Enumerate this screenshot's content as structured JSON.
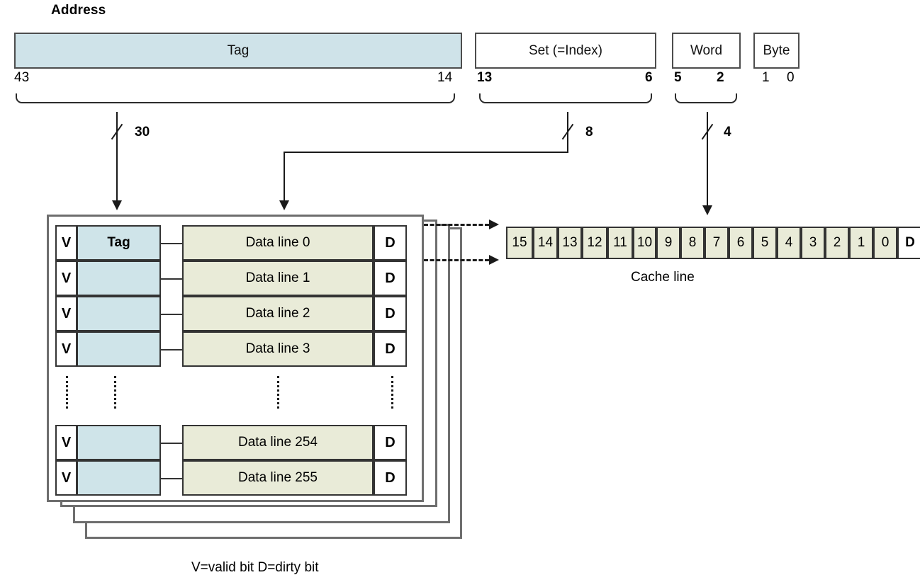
{
  "diagram": {
    "title": "Address",
    "legend": "V=valid bit        D=dirty bit",
    "cache_line_caption": "Cache line"
  },
  "address_fields": [
    {
      "label": "Tag",
      "hi": "43",
      "lo": "14",
      "bold_bits": false,
      "filled": true,
      "width_annotation": "30"
    },
    {
      "label": "Set (=Index)",
      "hi": "13",
      "lo": "6",
      "bold_bits": true,
      "filled": false,
      "width_annotation": "8"
    },
    {
      "label": "Word",
      "hi": "5",
      "lo": "2",
      "bold_bits": true,
      "filled": false,
      "width_annotation": "4"
    },
    {
      "label": "Byte",
      "hi": "1",
      "lo": "0",
      "bold_bits": false,
      "filled": false,
      "width_annotation": ""
    }
  ],
  "cache_array": {
    "valid_label": "V",
    "dirty_label": "D",
    "tag_header": "Tag",
    "rows_top": [
      {
        "data": "Data line 0"
      },
      {
        "data": "Data line 1"
      },
      {
        "data": "Data line 2"
      },
      {
        "data": "Data line 3"
      }
    ],
    "rows_bottom": [
      {
        "data": "Data line 254"
      },
      {
        "data": "Data line 255"
      }
    ]
  },
  "cache_line": {
    "words": [
      "15",
      "14",
      "13",
      "12",
      "11",
      "10",
      "9",
      "8",
      "7",
      "6",
      "5",
      "4",
      "3",
      "2",
      "1",
      "0"
    ],
    "dirty_label": "D"
  },
  "colors": {
    "tag_fill": "#cfe3e9",
    "data_fill": "#e9ebd8",
    "line": "#1a1a1a",
    "box_border": "#4d4d4d"
  }
}
